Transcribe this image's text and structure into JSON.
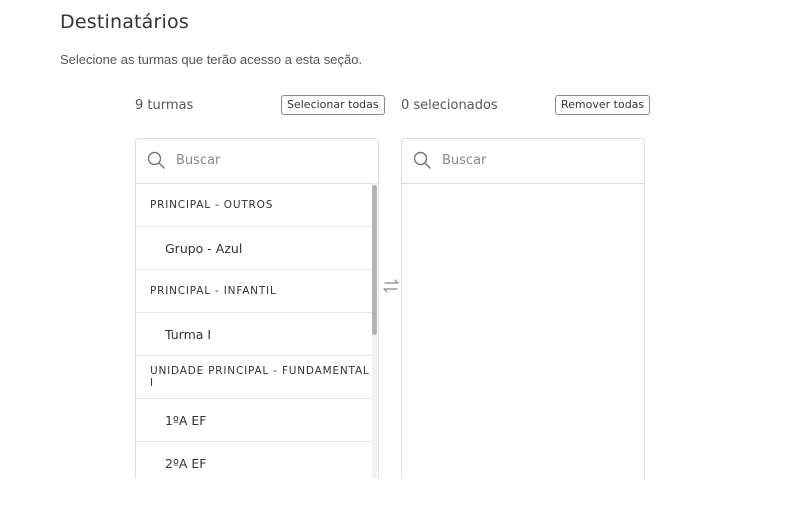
{
  "section": {
    "title": "Destinatários",
    "subtitle": "Selecione as turmas que terão acesso a esta seção."
  },
  "left": {
    "count_label": "9 turmas",
    "button_label": "Selecionar todas",
    "search_placeholder": "Buscar",
    "rows": [
      {
        "type": "group",
        "label": "PRINCIPAL - OUTROS"
      },
      {
        "type": "item",
        "label": "Grupo - Azul"
      },
      {
        "type": "group",
        "label": "PRINCIPAL - INFANTIL"
      },
      {
        "type": "item",
        "label": "Turma I"
      },
      {
        "type": "group",
        "label": "UNIDADE PRINCIPAL - FUNDAMENTAL I"
      },
      {
        "type": "item",
        "label": "1ºA EF"
      },
      {
        "type": "item",
        "label": "2ºA EF"
      }
    ]
  },
  "right": {
    "count_label": "0 selecionados",
    "button_label": "Remover todas",
    "search_placeholder": "Buscar"
  },
  "icons": {
    "search": "search-icon",
    "transfer": "transfer-arrows-icon"
  }
}
